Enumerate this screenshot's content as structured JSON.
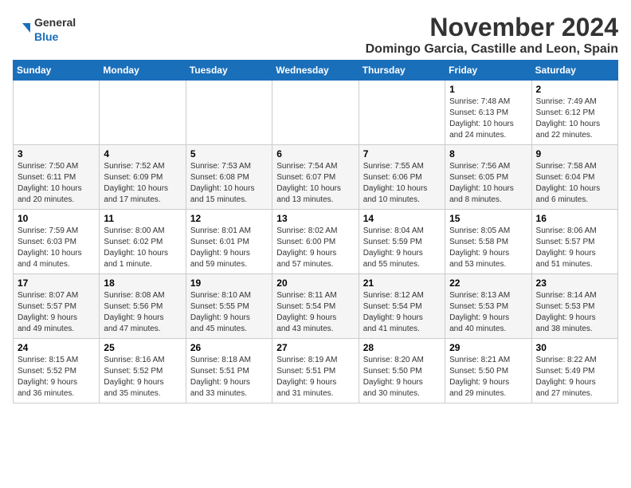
{
  "logo": {
    "text_general": "General",
    "text_blue": "Blue"
  },
  "header": {
    "month": "November 2024",
    "location": "Domingo Garcia, Castille and Leon, Spain"
  },
  "weekdays": [
    "Sunday",
    "Monday",
    "Tuesday",
    "Wednesday",
    "Thursday",
    "Friday",
    "Saturday"
  ],
  "weeks": [
    [
      {
        "day": "",
        "info": ""
      },
      {
        "day": "",
        "info": ""
      },
      {
        "day": "",
        "info": ""
      },
      {
        "day": "",
        "info": ""
      },
      {
        "day": "",
        "info": ""
      },
      {
        "day": "1",
        "info": "Sunrise: 7:48 AM\nSunset: 6:13 PM\nDaylight: 10 hours\nand 24 minutes."
      },
      {
        "day": "2",
        "info": "Sunrise: 7:49 AM\nSunset: 6:12 PM\nDaylight: 10 hours\nand 22 minutes."
      }
    ],
    [
      {
        "day": "3",
        "info": "Sunrise: 7:50 AM\nSunset: 6:11 PM\nDaylight: 10 hours\nand 20 minutes."
      },
      {
        "day": "4",
        "info": "Sunrise: 7:52 AM\nSunset: 6:09 PM\nDaylight: 10 hours\nand 17 minutes."
      },
      {
        "day": "5",
        "info": "Sunrise: 7:53 AM\nSunset: 6:08 PM\nDaylight: 10 hours\nand 15 minutes."
      },
      {
        "day": "6",
        "info": "Sunrise: 7:54 AM\nSunset: 6:07 PM\nDaylight: 10 hours\nand 13 minutes."
      },
      {
        "day": "7",
        "info": "Sunrise: 7:55 AM\nSunset: 6:06 PM\nDaylight: 10 hours\nand 10 minutes."
      },
      {
        "day": "8",
        "info": "Sunrise: 7:56 AM\nSunset: 6:05 PM\nDaylight: 10 hours\nand 8 minutes."
      },
      {
        "day": "9",
        "info": "Sunrise: 7:58 AM\nSunset: 6:04 PM\nDaylight: 10 hours\nand 6 minutes."
      }
    ],
    [
      {
        "day": "10",
        "info": "Sunrise: 7:59 AM\nSunset: 6:03 PM\nDaylight: 10 hours\nand 4 minutes."
      },
      {
        "day": "11",
        "info": "Sunrise: 8:00 AM\nSunset: 6:02 PM\nDaylight: 10 hours\nand 1 minute."
      },
      {
        "day": "12",
        "info": "Sunrise: 8:01 AM\nSunset: 6:01 PM\nDaylight: 9 hours\nand 59 minutes."
      },
      {
        "day": "13",
        "info": "Sunrise: 8:02 AM\nSunset: 6:00 PM\nDaylight: 9 hours\nand 57 minutes."
      },
      {
        "day": "14",
        "info": "Sunrise: 8:04 AM\nSunset: 5:59 PM\nDaylight: 9 hours\nand 55 minutes."
      },
      {
        "day": "15",
        "info": "Sunrise: 8:05 AM\nSunset: 5:58 PM\nDaylight: 9 hours\nand 53 minutes."
      },
      {
        "day": "16",
        "info": "Sunrise: 8:06 AM\nSunset: 5:57 PM\nDaylight: 9 hours\nand 51 minutes."
      }
    ],
    [
      {
        "day": "17",
        "info": "Sunrise: 8:07 AM\nSunset: 5:57 PM\nDaylight: 9 hours\nand 49 minutes."
      },
      {
        "day": "18",
        "info": "Sunrise: 8:08 AM\nSunset: 5:56 PM\nDaylight: 9 hours\nand 47 minutes."
      },
      {
        "day": "19",
        "info": "Sunrise: 8:10 AM\nSunset: 5:55 PM\nDaylight: 9 hours\nand 45 minutes."
      },
      {
        "day": "20",
        "info": "Sunrise: 8:11 AM\nSunset: 5:54 PM\nDaylight: 9 hours\nand 43 minutes."
      },
      {
        "day": "21",
        "info": "Sunrise: 8:12 AM\nSunset: 5:54 PM\nDaylight: 9 hours\nand 41 minutes."
      },
      {
        "day": "22",
        "info": "Sunrise: 8:13 AM\nSunset: 5:53 PM\nDaylight: 9 hours\nand 40 minutes."
      },
      {
        "day": "23",
        "info": "Sunrise: 8:14 AM\nSunset: 5:53 PM\nDaylight: 9 hours\nand 38 minutes."
      }
    ],
    [
      {
        "day": "24",
        "info": "Sunrise: 8:15 AM\nSunset: 5:52 PM\nDaylight: 9 hours\nand 36 minutes."
      },
      {
        "day": "25",
        "info": "Sunrise: 8:16 AM\nSunset: 5:52 PM\nDaylight: 9 hours\nand 35 minutes."
      },
      {
        "day": "26",
        "info": "Sunrise: 8:18 AM\nSunset: 5:51 PM\nDaylight: 9 hours\nand 33 minutes."
      },
      {
        "day": "27",
        "info": "Sunrise: 8:19 AM\nSunset: 5:51 PM\nDaylight: 9 hours\nand 31 minutes."
      },
      {
        "day": "28",
        "info": "Sunrise: 8:20 AM\nSunset: 5:50 PM\nDaylight: 9 hours\nand 30 minutes."
      },
      {
        "day": "29",
        "info": "Sunrise: 8:21 AM\nSunset: 5:50 PM\nDaylight: 9 hours\nand 29 minutes."
      },
      {
        "day": "30",
        "info": "Sunrise: 8:22 AM\nSunset: 5:49 PM\nDaylight: 9 hours\nand 27 minutes."
      }
    ]
  ]
}
